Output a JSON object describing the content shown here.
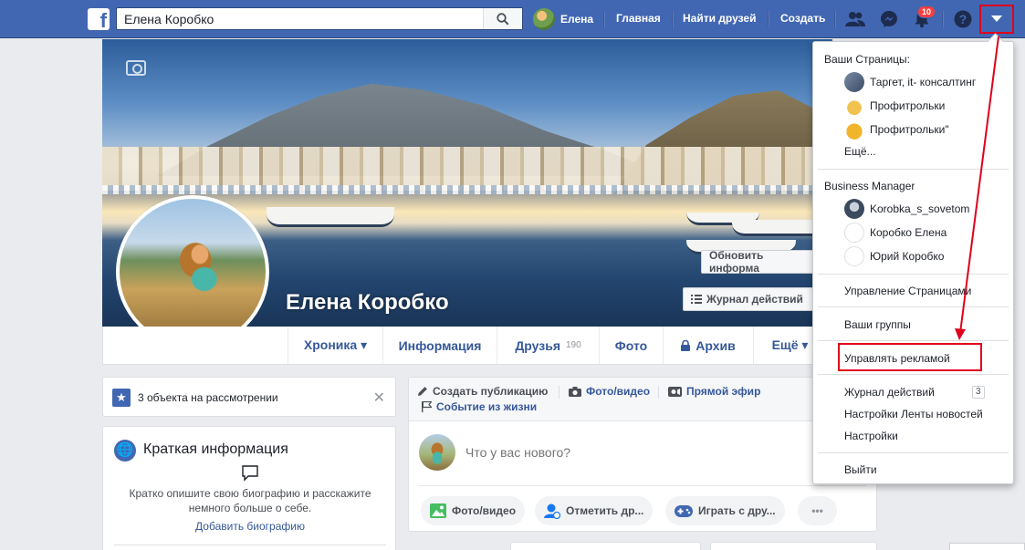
{
  "topbar": {
    "search_value": "Елена Коробко",
    "user_name": "Елена",
    "nav_home": "Главная",
    "nav_find_friends": "Найти друзей",
    "nav_create": "Создать",
    "notifications_count": "10",
    "brand_color": "#4267b2"
  },
  "profile": {
    "name": "Елена Коробко",
    "update_info_button": "Обновить информа",
    "activity_log_button": "Журнал действий",
    "tabs": [
      {
        "label": "Хроника ▾"
      },
      {
        "label": "Информация"
      },
      {
        "label": "Друзья",
        "count": "190"
      },
      {
        "label": "Фото"
      },
      {
        "label": "Архив"
      },
      {
        "label": "Ещё ▾"
      }
    ]
  },
  "review": {
    "text": "3 объекта на рассмотрении"
  },
  "intro": {
    "title": "Краткая информация",
    "prompt": "Кратко опишите свою биографию и расскажите немного больше о себе.",
    "add_bio_link": "Добавить биографию"
  },
  "composer": {
    "create_post": "Создать публикацию",
    "photo_video_tab": "Фото/видео",
    "live": "Прямой эфир",
    "life_event": "Событие из жизни",
    "placeholder": "Что у вас нового?",
    "pills": [
      "Фото/видео",
      "Отметить др...",
      "Играть с дру...",
      "•••"
    ]
  },
  "menu": {
    "pages_header": "Ваши Страницы:",
    "pages": [
      "Таргет, it- консалтинг",
      "Профитрольки",
      "Профитрольки\""
    ],
    "pages_more": "Ещё...",
    "bm_header": "Business Manager",
    "bm_accounts": [
      "Korobka_s_sovetom",
      "Коробко Елена",
      "Юрий Коробко"
    ],
    "manage_pages": "Управление Страницами",
    "your_groups": "Ваши группы",
    "manage_ads": "Управлять рекламой",
    "activity_log": "Журнал действий",
    "activity_log_count": "3",
    "news_feed_settings": "Настройки Ленты новостей",
    "settings": "Настройки",
    "logout": "Выйти",
    "annotation_color": "#e0001b"
  }
}
